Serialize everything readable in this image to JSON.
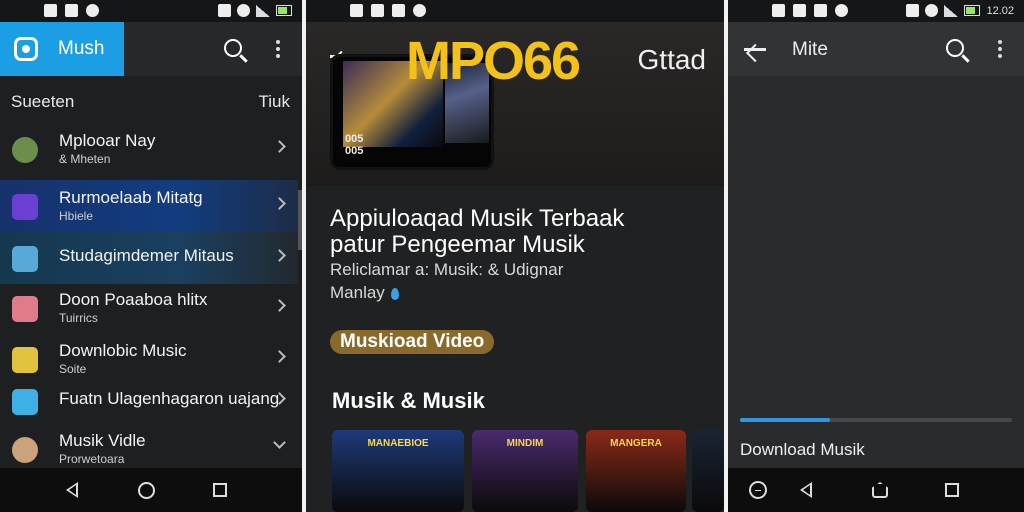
{
  "left_panel": {
    "status": {
      "time": ""
    },
    "app_name": "Mush",
    "section": {
      "title": "Sueeten",
      "action": "Tiuk"
    },
    "items": [
      {
        "title": "Mplooar Nay",
        "subtitle": "& Mheten",
        "icon": "waveform-icon",
        "color": "#6a8f4a"
      },
      {
        "title": "Rurmoelaab Mitatg",
        "subtitle": "Hbiele",
        "icon": "box-icon",
        "color": "#6a3fd1"
      },
      {
        "title": "Studagimdemer Mitaus",
        "subtitle": "",
        "icon": "gear-network-icon",
        "color": "#59a9d8"
      },
      {
        "title": "Doon Poaaboa hlitx",
        "subtitle": "Tuirrics",
        "icon": "document-icon",
        "color": "#e07b8a"
      },
      {
        "title": "Downlobic Music",
        "subtitle": "Soite",
        "icon": "folder-icon",
        "color": "#e0c23e"
      },
      {
        "title": "Fuatn Ulagenhagaron uajang",
        "subtitle": "",
        "icon": "image-icon",
        "color": "#3db0e6"
      },
      {
        "title": "Musik Vidle",
        "subtitle": "Prorwetoara",
        "icon": "avatar",
        "color": "#caa27c"
      }
    ]
  },
  "center_panel": {
    "hero_title": "MPO66",
    "hero_side": "Gttad",
    "poster_number": "005\n005",
    "headline_line1": "Appiuloaqad Musik Terbaak",
    "headline_line2": "patur Pengeemar Musik",
    "sub_line1": "Reliclamar a: Musik: & Udignar",
    "sub_line2": "Manlay",
    "pill_label": "Muskioad Video",
    "section_title": "Musik & Musik",
    "thumbnails": [
      {
        "caption": "MANAEBIOE",
        "bg": "#1e3a7a"
      },
      {
        "caption": "MINDIM",
        "bg": "#4a2a6e"
      },
      {
        "caption": "MANGERA",
        "bg": "#8a2a18"
      },
      {
        "caption": "",
        "bg": "#1a2434"
      }
    ]
  },
  "right_panel": {
    "title": "Mite",
    "download_label": "Download Musik",
    "progress": 0.33,
    "status_time": "12.02"
  }
}
